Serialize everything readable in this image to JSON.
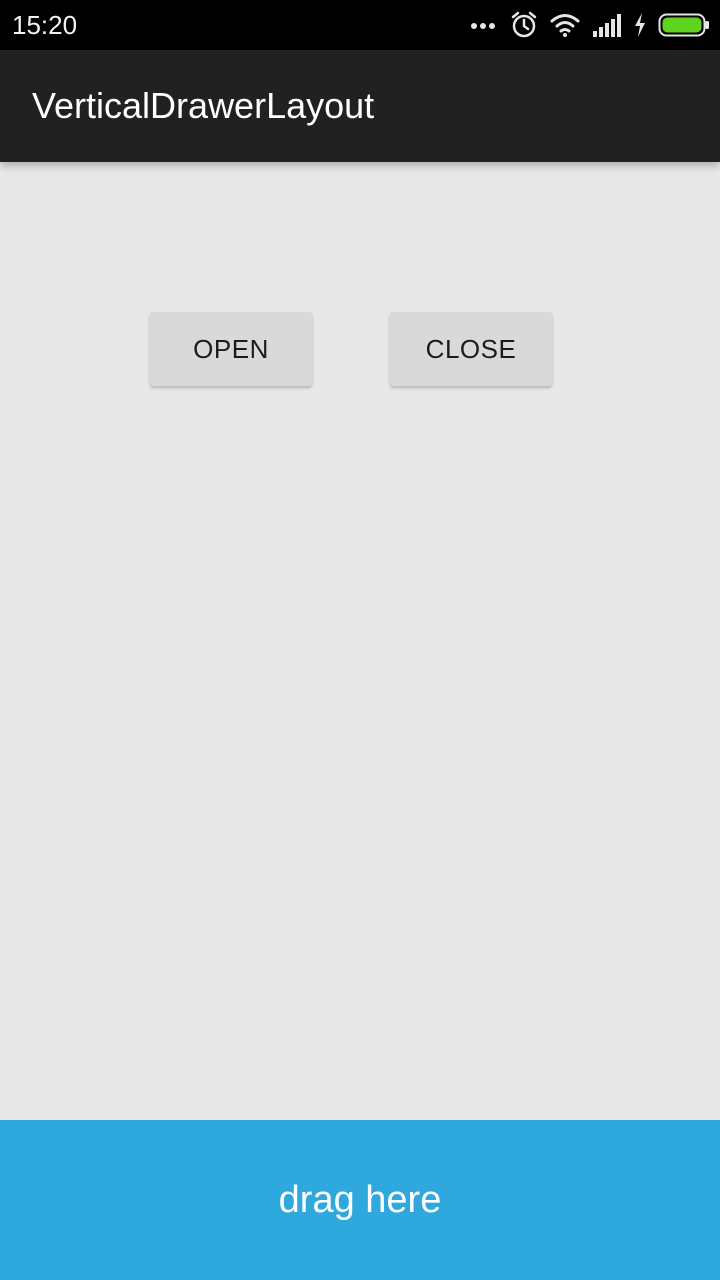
{
  "status_bar": {
    "time": "15:20",
    "icons": [
      "more-dots-icon",
      "alarm-icon",
      "wifi-icon",
      "signal-icon",
      "charging-icon",
      "battery-icon"
    ],
    "battery_color": "#5fd41e"
  },
  "app_bar": {
    "title": "VerticalDrawerLayout",
    "background": "#212121"
  },
  "main": {
    "open_label": "OPEN",
    "close_label": "CLOSE"
  },
  "drawer": {
    "label": "drag here",
    "background": "#2fa8dd"
  }
}
